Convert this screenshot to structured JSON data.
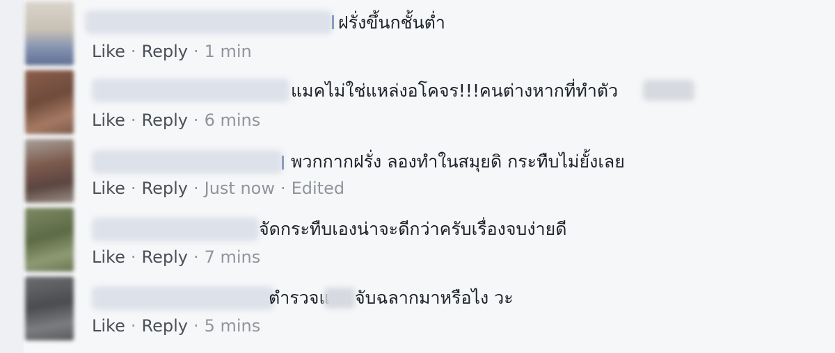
{
  "comments": [
    {
      "text": "ฝรั่งขึ้นกชั้นต่ำ",
      "like_label": "Like",
      "reply_label": "Reply",
      "time": "1 min",
      "edited": ""
    },
    {
      "text": "แมคไม่ใช่แหล่งอโคจร!!!คนต่างหากที่ทำตัว",
      "like_label": "Like",
      "reply_label": "Reply",
      "time": "6 mins",
      "edited": ""
    },
    {
      "text": "พวกกากฝรั่ง ลองทำในสมุยดิ กระทืบไม่ยั้งเลย",
      "like_label": "Like",
      "reply_label": "Reply",
      "time": "Just now",
      "edited": "Edited"
    },
    {
      "text": "จัดกระทืบเองน่าจะดีกว่าครับเรื่องจบง่ายดี",
      "like_label": "Like",
      "reply_label": "Reply",
      "time": "7 mins",
      "edited": ""
    },
    {
      "text_part1": "ตำรวจแ",
      "text_part2": "จับฉลากมาหรือไง วะ",
      "like_label": "Like",
      "reply_label": "Reply",
      "time": "5 mins",
      "edited": ""
    }
  ],
  "separator": "·",
  "colors": {
    "background": "#f6f7f9",
    "text": "#1d2129",
    "action_link": "#4b4f56",
    "meta": "#90949c"
  }
}
